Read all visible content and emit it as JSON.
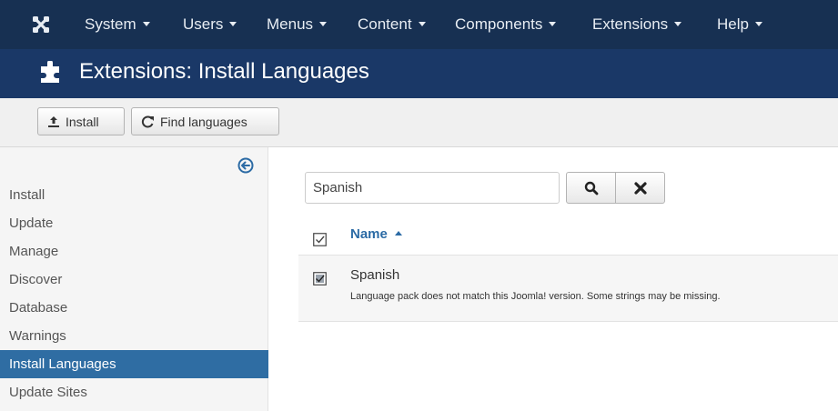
{
  "navbar": {
    "logo_icon": "joomla-logo-icon",
    "items": [
      {
        "label": "System"
      },
      {
        "label": "Users"
      },
      {
        "label": "Menus"
      },
      {
        "label": "Content"
      },
      {
        "label": "Components"
      },
      {
        "label": "Extensions"
      },
      {
        "label": "Help"
      }
    ]
  },
  "header": {
    "icon": "puzzle-piece-icon",
    "title": "Extensions: Install Languages"
  },
  "toolbar": {
    "install_label": "Install",
    "find_languages_label": "Find languages"
  },
  "sidebar": {
    "collapse_icon": "arrow-left-circle-icon",
    "items": [
      {
        "label": "Install"
      },
      {
        "label": "Update"
      },
      {
        "label": "Manage"
      },
      {
        "label": "Discover"
      },
      {
        "label": "Database"
      },
      {
        "label": "Warnings"
      },
      {
        "label": "Install Languages",
        "active": true
      },
      {
        "label": "Update Sites"
      }
    ]
  },
  "search": {
    "value": "Spanish",
    "search_icon": "search-icon",
    "clear_icon": "close-icon"
  },
  "table": {
    "columns": [
      {
        "label": "Name",
        "sort": "ascending"
      }
    ],
    "rows": [
      {
        "name": "Spanish",
        "description": "Language pack does not match this Joomla! version. Some strings may be missing."
      }
    ]
  },
  "colors": {
    "navbar_bg": "#173052",
    "titlebar_bg": "#1a3867",
    "sidebar_active_bg": "#2f6da3",
    "link": "#2c6ba5"
  }
}
